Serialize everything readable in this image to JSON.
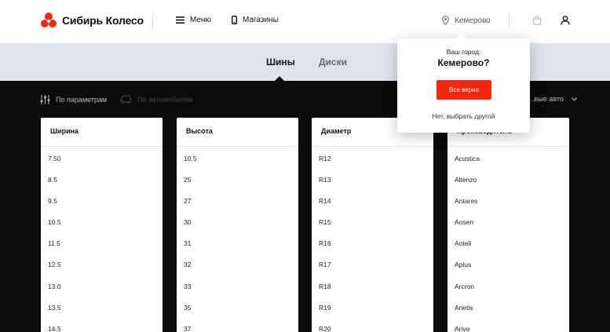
{
  "header": {
    "logo_text": "Сибирь Колесо",
    "menu_label": "Меню",
    "stores_label": "Магазины",
    "city_label": "Кемерово"
  },
  "tabs": [
    {
      "label": "Шины"
    },
    {
      "label": "Диски"
    }
  ],
  "filters": {
    "by_params": "По параметрам",
    "by_car": "По автомобилям",
    "right_label": "...вые авто"
  },
  "columns": [
    {
      "header": "Ширина",
      "items": [
        "7.50",
        "8.5",
        "9.5",
        "10.5",
        "11.5",
        "12.5",
        "13.0",
        "13.5",
        "14.5"
      ]
    },
    {
      "header": "Высота",
      "items": [
        "10.5",
        "25",
        "27",
        "30",
        "31",
        "32",
        "33",
        "35",
        "37"
      ]
    },
    {
      "header": "Диаметр",
      "items": [
        "R12",
        "R13",
        "R14",
        "R15",
        "R16",
        "R17",
        "R18",
        "R19",
        "R20"
      ]
    },
    {
      "header": "Производитель",
      "items": [
        "Acustica",
        "Altenzo",
        "Antares",
        "Aosen",
        "Aoteli",
        "Aplus",
        "Arcron",
        "Arietis",
        "Arivo"
      ]
    }
  ],
  "city_popup": {
    "question": "Ваш город:",
    "city": "Кемерово?",
    "confirm": "Все верно",
    "other": "Нет, выбрать другой"
  },
  "colors": {
    "accent": "#f5270e",
    "tabs_bg": "#dfe3ee",
    "page_bg": "#0b0b0b"
  }
}
